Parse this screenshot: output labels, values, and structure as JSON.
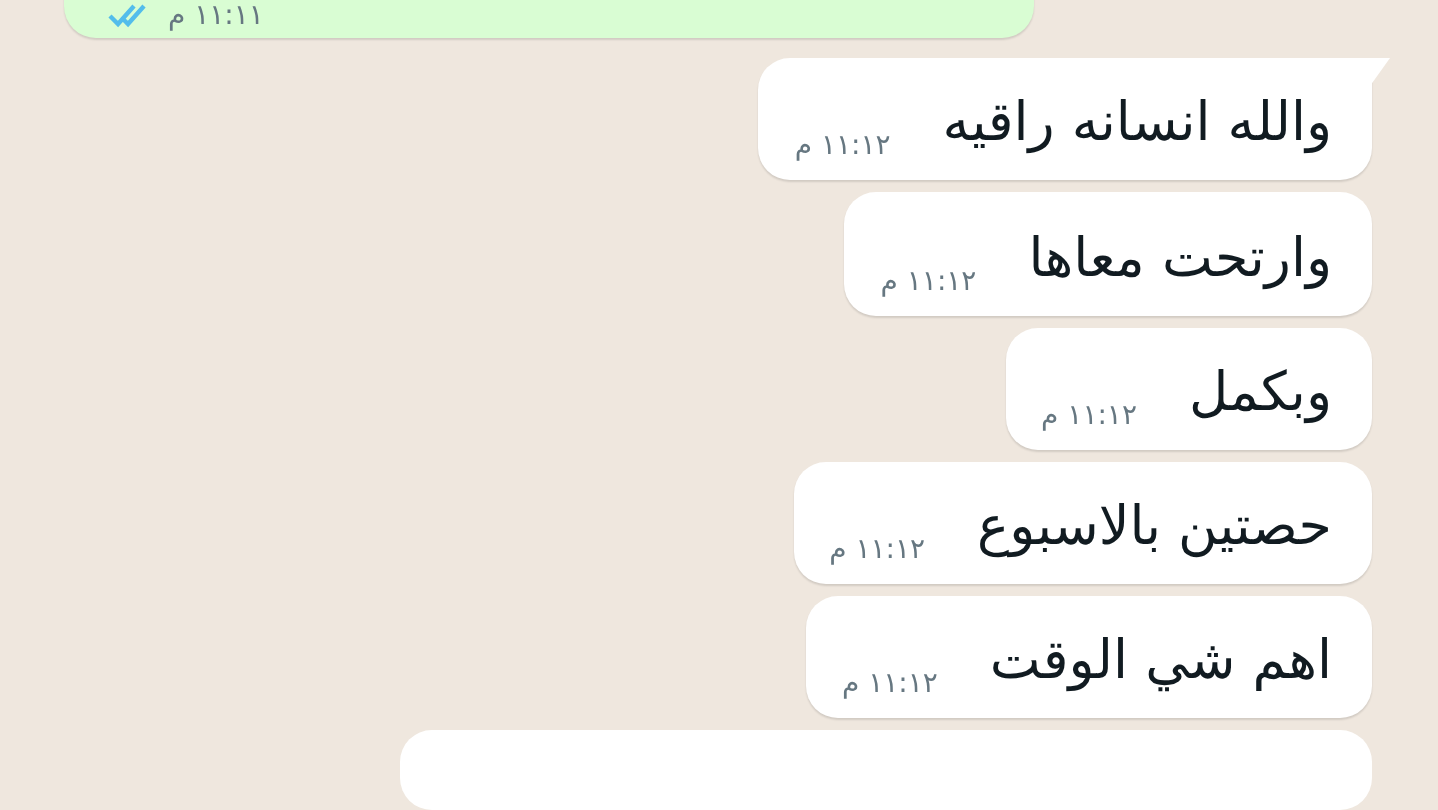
{
  "messages": [
    {
      "kind": "sent",
      "time": "١١:١١ م",
      "read": true
    },
    {
      "kind": "received",
      "text": "والله انسانه راقيه",
      "time": "١١:١٢ م",
      "tail": true
    },
    {
      "kind": "received",
      "text": "وارتحت معاها",
      "time": "١١:١٢ م",
      "tail": false
    },
    {
      "kind": "received",
      "text": "وبكمل",
      "time": "١١:١٢ م",
      "tail": false
    },
    {
      "kind": "received",
      "text": "حصتين بالاسبوع",
      "time": "١١:١٢ م",
      "tail": false
    },
    {
      "kind": "received",
      "text": "اهم شي الوقت",
      "time": "١١:١٢ م",
      "tail": false
    },
    {
      "kind": "received_cut"
    }
  ]
}
